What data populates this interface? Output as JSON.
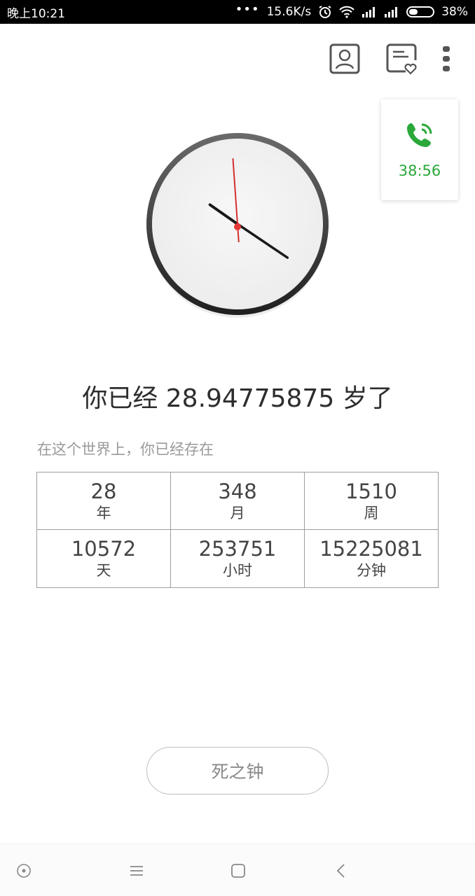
{
  "status_bar": {
    "time": "晚上10:21",
    "dots": "•••",
    "speed": "15.6K/s",
    "battery": "38%",
    "battery_level": 0.38
  },
  "call_widget": {
    "time": "38:56",
    "icon": "phone-call-icon",
    "color": "#2aa83a"
  },
  "clock": {
    "hour_hand_deg": -55,
    "minute_hand_deg": 124,
    "second_hand_deg": -4,
    "center_color": "#e53935"
  },
  "age_text": "你已经 28.94775875 岁了",
  "exist_text": "在这个世界上，你已经存在",
  "stats": [
    {
      "value": "28",
      "unit": "年"
    },
    {
      "value": "348",
      "unit": "月"
    },
    {
      "value": "1510",
      "unit": "周"
    },
    {
      "value": "10572",
      "unit": "天"
    },
    {
      "value": "253751",
      "unit": "小时"
    },
    {
      "value": "15225081",
      "unit": "分钟"
    }
  ],
  "death_button_label": "死之钟"
}
